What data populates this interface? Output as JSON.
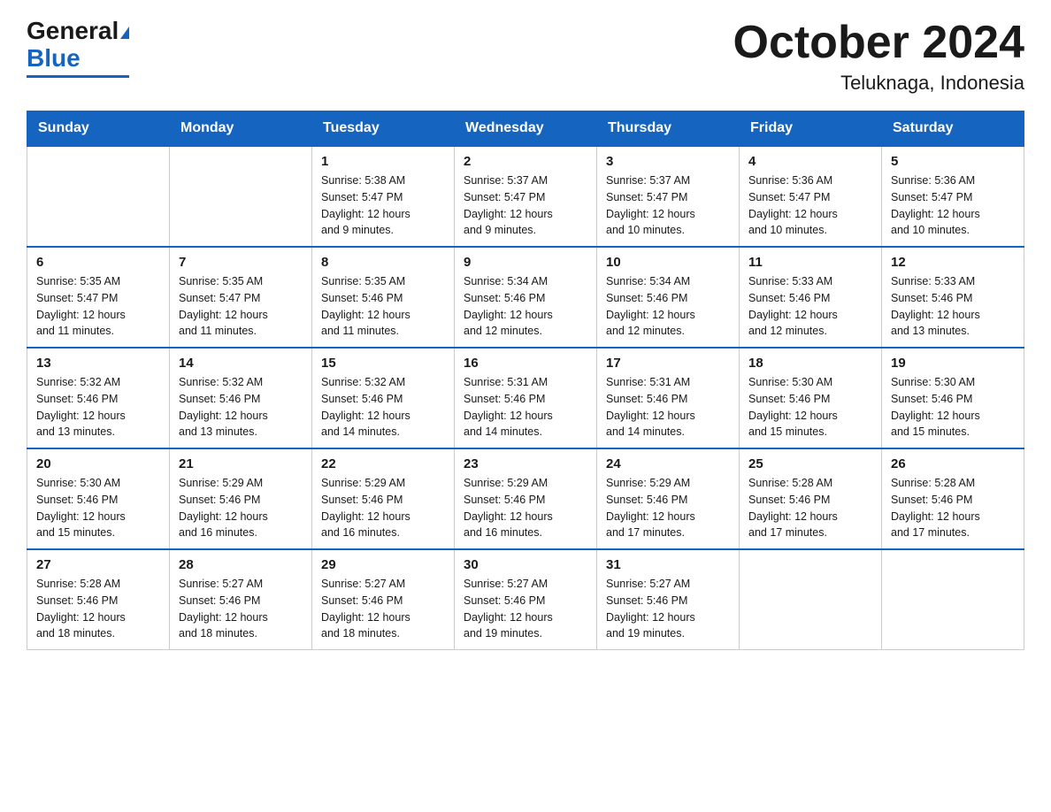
{
  "header": {
    "logo_general": "General",
    "logo_blue": "Blue",
    "main_title": "October 2024",
    "subtitle": "Teluknaga, Indonesia"
  },
  "calendar": {
    "days_of_week": [
      "Sunday",
      "Monday",
      "Tuesday",
      "Wednesday",
      "Thursday",
      "Friday",
      "Saturday"
    ],
    "weeks": [
      [
        {
          "day": "",
          "info": ""
        },
        {
          "day": "",
          "info": ""
        },
        {
          "day": "1",
          "info": "Sunrise: 5:38 AM\nSunset: 5:47 PM\nDaylight: 12 hours\nand 9 minutes."
        },
        {
          "day": "2",
          "info": "Sunrise: 5:37 AM\nSunset: 5:47 PM\nDaylight: 12 hours\nand 9 minutes."
        },
        {
          "day": "3",
          "info": "Sunrise: 5:37 AM\nSunset: 5:47 PM\nDaylight: 12 hours\nand 10 minutes."
        },
        {
          "day": "4",
          "info": "Sunrise: 5:36 AM\nSunset: 5:47 PM\nDaylight: 12 hours\nand 10 minutes."
        },
        {
          "day": "5",
          "info": "Sunrise: 5:36 AM\nSunset: 5:47 PM\nDaylight: 12 hours\nand 10 minutes."
        }
      ],
      [
        {
          "day": "6",
          "info": "Sunrise: 5:35 AM\nSunset: 5:47 PM\nDaylight: 12 hours\nand 11 minutes."
        },
        {
          "day": "7",
          "info": "Sunrise: 5:35 AM\nSunset: 5:47 PM\nDaylight: 12 hours\nand 11 minutes."
        },
        {
          "day": "8",
          "info": "Sunrise: 5:35 AM\nSunset: 5:46 PM\nDaylight: 12 hours\nand 11 minutes."
        },
        {
          "day": "9",
          "info": "Sunrise: 5:34 AM\nSunset: 5:46 PM\nDaylight: 12 hours\nand 12 minutes."
        },
        {
          "day": "10",
          "info": "Sunrise: 5:34 AM\nSunset: 5:46 PM\nDaylight: 12 hours\nand 12 minutes."
        },
        {
          "day": "11",
          "info": "Sunrise: 5:33 AM\nSunset: 5:46 PM\nDaylight: 12 hours\nand 12 minutes."
        },
        {
          "day": "12",
          "info": "Sunrise: 5:33 AM\nSunset: 5:46 PM\nDaylight: 12 hours\nand 13 minutes."
        }
      ],
      [
        {
          "day": "13",
          "info": "Sunrise: 5:32 AM\nSunset: 5:46 PM\nDaylight: 12 hours\nand 13 minutes."
        },
        {
          "day": "14",
          "info": "Sunrise: 5:32 AM\nSunset: 5:46 PM\nDaylight: 12 hours\nand 13 minutes."
        },
        {
          "day": "15",
          "info": "Sunrise: 5:32 AM\nSunset: 5:46 PM\nDaylight: 12 hours\nand 14 minutes."
        },
        {
          "day": "16",
          "info": "Sunrise: 5:31 AM\nSunset: 5:46 PM\nDaylight: 12 hours\nand 14 minutes."
        },
        {
          "day": "17",
          "info": "Sunrise: 5:31 AM\nSunset: 5:46 PM\nDaylight: 12 hours\nand 14 minutes."
        },
        {
          "day": "18",
          "info": "Sunrise: 5:30 AM\nSunset: 5:46 PM\nDaylight: 12 hours\nand 15 minutes."
        },
        {
          "day": "19",
          "info": "Sunrise: 5:30 AM\nSunset: 5:46 PM\nDaylight: 12 hours\nand 15 minutes."
        }
      ],
      [
        {
          "day": "20",
          "info": "Sunrise: 5:30 AM\nSunset: 5:46 PM\nDaylight: 12 hours\nand 15 minutes."
        },
        {
          "day": "21",
          "info": "Sunrise: 5:29 AM\nSunset: 5:46 PM\nDaylight: 12 hours\nand 16 minutes."
        },
        {
          "day": "22",
          "info": "Sunrise: 5:29 AM\nSunset: 5:46 PM\nDaylight: 12 hours\nand 16 minutes."
        },
        {
          "day": "23",
          "info": "Sunrise: 5:29 AM\nSunset: 5:46 PM\nDaylight: 12 hours\nand 16 minutes."
        },
        {
          "day": "24",
          "info": "Sunrise: 5:29 AM\nSunset: 5:46 PM\nDaylight: 12 hours\nand 17 minutes."
        },
        {
          "day": "25",
          "info": "Sunrise: 5:28 AM\nSunset: 5:46 PM\nDaylight: 12 hours\nand 17 minutes."
        },
        {
          "day": "26",
          "info": "Sunrise: 5:28 AM\nSunset: 5:46 PM\nDaylight: 12 hours\nand 17 minutes."
        }
      ],
      [
        {
          "day": "27",
          "info": "Sunrise: 5:28 AM\nSunset: 5:46 PM\nDaylight: 12 hours\nand 18 minutes."
        },
        {
          "day": "28",
          "info": "Sunrise: 5:27 AM\nSunset: 5:46 PM\nDaylight: 12 hours\nand 18 minutes."
        },
        {
          "day": "29",
          "info": "Sunrise: 5:27 AM\nSunset: 5:46 PM\nDaylight: 12 hours\nand 18 minutes."
        },
        {
          "day": "30",
          "info": "Sunrise: 5:27 AM\nSunset: 5:46 PM\nDaylight: 12 hours\nand 19 minutes."
        },
        {
          "day": "31",
          "info": "Sunrise: 5:27 AM\nSunset: 5:46 PM\nDaylight: 12 hours\nand 19 minutes."
        },
        {
          "day": "",
          "info": ""
        },
        {
          "day": "",
          "info": ""
        }
      ]
    ]
  }
}
